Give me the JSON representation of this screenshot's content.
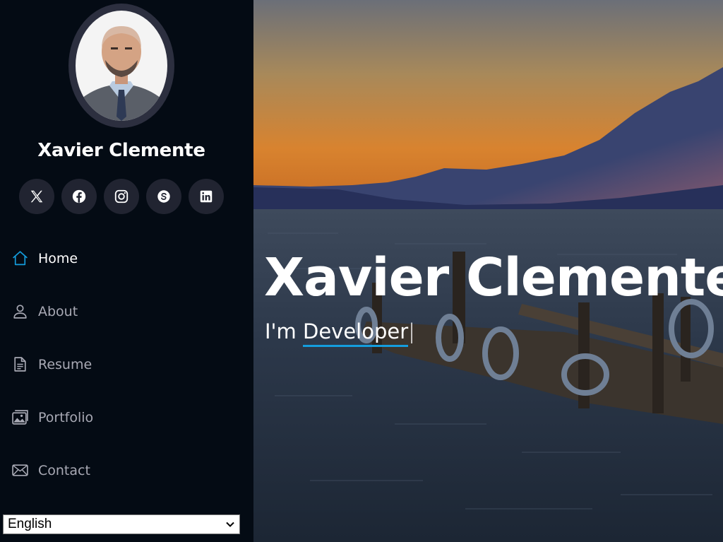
{
  "profile": {
    "name": "Xavier Clemente"
  },
  "social": [
    {
      "icon": "x-twitter-icon"
    },
    {
      "icon": "facebook-icon"
    },
    {
      "icon": "instagram-icon"
    },
    {
      "icon": "skype-icon"
    },
    {
      "icon": "linkedin-icon"
    }
  ],
  "nav": {
    "items": [
      {
        "label": "Home",
        "icon": "home-icon",
        "active": true
      },
      {
        "label": "About",
        "icon": "person-icon",
        "active": false
      },
      {
        "label": "Resume",
        "icon": "file-icon",
        "active": false
      },
      {
        "label": "Portfolio",
        "icon": "images-icon",
        "active": false
      },
      {
        "label": "Contact",
        "icon": "envelope-icon",
        "active": false
      }
    ]
  },
  "language": {
    "selected": "English"
  },
  "hero": {
    "title": "Xavier Clemente",
    "prefix": "I'm",
    "typed": "Developer",
    "cursor": "|"
  },
  "colors": {
    "accent": "#149ddd",
    "sidebar_bg": "#040b14",
    "social_bg": "#212431",
    "nav_text": "#a8a9b4"
  }
}
